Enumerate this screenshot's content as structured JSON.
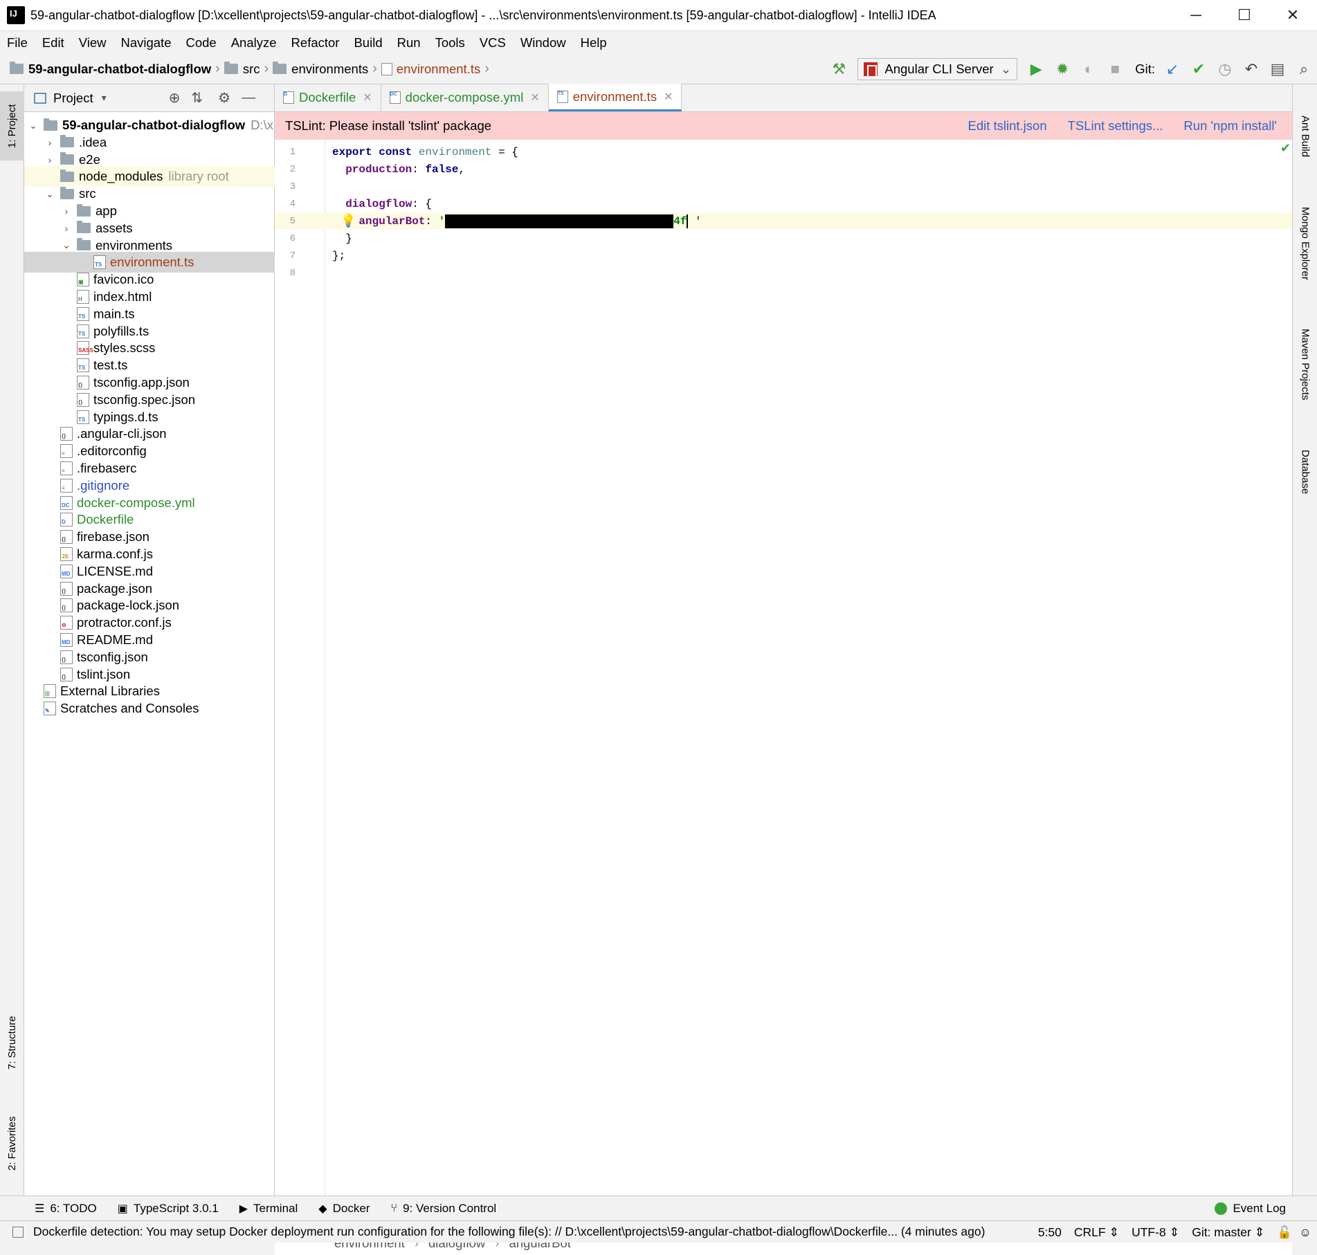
{
  "window": {
    "title": "59-angular-chatbot-dialogflow [D:\\xcellent\\projects\\59-angular-chatbot-dialogflow] - ...\\src\\environments\\environment.ts [59-angular-chatbot-dialogflow] - IntelliJ IDEA",
    "minimize": "─",
    "maximize": "☐",
    "close": "✕"
  },
  "menu": [
    "File",
    "Edit",
    "View",
    "Navigate",
    "Code",
    "Analyze",
    "Refactor",
    "Build",
    "Run",
    "Tools",
    "VCS",
    "Window",
    "Help"
  ],
  "breadcrumb": [
    "59-angular-chatbot-dialogflow",
    "src",
    "environments",
    "environment.ts"
  ],
  "toolbar": {
    "run_config": "Angular CLI Server",
    "git_label": "Git:"
  },
  "left_stripe": {
    "project_tab": "1: Project",
    "structure_tab": "7: Structure",
    "favorites_tab": "2: Favorites"
  },
  "project_panel": {
    "header": "Project",
    "root": "59-angular-chatbot-dialogflow",
    "root_path": "D:\\x",
    "items": [
      {
        "name": ".idea",
        "type": "folder",
        "depth": 1,
        "arrow": "›"
      },
      {
        "name": "e2e",
        "type": "folder",
        "depth": 1,
        "arrow": "›"
      },
      {
        "name": "node_modules",
        "type": "folder",
        "depth": 1,
        "arrow": "",
        "suffix": "library root",
        "highlight": true
      },
      {
        "name": "src",
        "type": "folder",
        "depth": 1,
        "arrow": "⌄"
      },
      {
        "name": "app",
        "type": "folder",
        "depth": 2,
        "arrow": "›"
      },
      {
        "name": "assets",
        "type": "folder",
        "depth": 2,
        "arrow": "›"
      },
      {
        "name": "environments",
        "type": "folder",
        "depth": 2,
        "arrow": "⌄"
      },
      {
        "name": "environment.ts",
        "type": "ts",
        "depth": 3,
        "selected": true
      },
      {
        "name": "favicon.ico",
        "type": "img",
        "depth": 2
      },
      {
        "name": "index.html",
        "type": "html",
        "depth": 2
      },
      {
        "name": "main.ts",
        "type": "ts",
        "depth": 2
      },
      {
        "name": "polyfills.ts",
        "type": "ts",
        "depth": 2
      },
      {
        "name": "styles.scss",
        "type": "sass",
        "depth": 2
      },
      {
        "name": "test.ts",
        "type": "ts",
        "depth": 2
      },
      {
        "name": "tsconfig.app.json",
        "type": "json",
        "depth": 2
      },
      {
        "name": "tsconfig.spec.json",
        "type": "json",
        "depth": 2
      },
      {
        "name": "typings.d.ts",
        "type": "ts",
        "depth": 2
      },
      {
        "name": ".angular-cli.json",
        "type": "json",
        "depth": 1
      },
      {
        "name": ".editorconfig",
        "type": "text",
        "depth": 1
      },
      {
        "name": ".firebaserc",
        "type": "text",
        "depth": 1
      },
      {
        "name": ".gitignore",
        "type": "text",
        "depth": 1,
        "color": "#2f4dbf"
      },
      {
        "name": "docker-compose.yml",
        "type": "dc",
        "depth": 1,
        "color": "#2e8b2e"
      },
      {
        "name": "Dockerfile",
        "type": "docker",
        "depth": 1,
        "color": "#2e8b2e"
      },
      {
        "name": "firebase.json",
        "type": "json",
        "depth": 1
      },
      {
        "name": "karma.conf.js",
        "type": "js",
        "depth": 1
      },
      {
        "name": "LICENSE.md",
        "type": "md",
        "depth": 1
      },
      {
        "name": "package.json",
        "type": "json",
        "depth": 1
      },
      {
        "name": "package-lock.json",
        "type": "json",
        "depth": 1
      },
      {
        "name": "protractor.conf.js",
        "type": "protractor",
        "depth": 1
      },
      {
        "name": "README.md",
        "type": "md",
        "depth": 1
      },
      {
        "name": "tsconfig.json",
        "type": "json",
        "depth": 1
      },
      {
        "name": "tslint.json",
        "type": "json",
        "depth": 1
      },
      {
        "name": "External Libraries",
        "type": "libs",
        "depth": 0
      },
      {
        "name": "Scratches and Consoles",
        "type": "scratch",
        "depth": 0
      }
    ]
  },
  "tabs": [
    {
      "label": "Dockerfile",
      "icon": "D",
      "color": "#2e8b2e",
      "active": false
    },
    {
      "label": "docker-compose.yml",
      "icon": "DC",
      "color": "#2e8b2e",
      "active": false
    },
    {
      "label": "environment.ts",
      "icon": "TS",
      "color": "#a33c14",
      "active": true
    }
  ],
  "tslint_banner": {
    "message": "TSLint: Please install 'tslint' package",
    "actions": [
      "Edit tslint.json",
      "TSLint settings...",
      "Run 'npm install'"
    ]
  },
  "code_lines": [
    "1",
    "2",
    "3",
    "4",
    "5",
    "6",
    "7",
    "8"
  ],
  "code": {
    "kw_export": "export",
    "kw_const": "const",
    "ident_env": "environment",
    "eq_brace": " = {",
    "prop_production": "production",
    "colon": ":",
    "kw_false": "false",
    "comma": ",",
    "prop_dialogflow": "dialogflow",
    "colon_brace": ": {",
    "prop_angularbot": "angularBot",
    "str_open": "'",
    "str_tail": "4f",
    "str_close": " '",
    "close_inner": "}",
    "close_outer": "};"
  },
  "editor_breadcrumb": [
    "environment",
    "dialogflow",
    "angularBot"
  ],
  "right_stripe": [
    "Ant Build",
    "Mongo Explorer",
    "Maven Projects",
    "Database"
  ],
  "tool_windows": [
    {
      "label": "6: TODO",
      "icon": "☰"
    },
    {
      "label": "TypeScript 3.0.1",
      "icon": "▣"
    },
    {
      "label": "Terminal",
      "icon": "▶"
    },
    {
      "label": "Docker",
      "icon": "◆"
    },
    {
      "label": "9: Version Control",
      "icon": "⑂"
    }
  ],
  "event_log": "Event Log",
  "status": {
    "message": "Dockerfile detection: You may setup Docker deployment run configuration for the following file(s): // D:\\xcellent\\projects\\59-angular-chatbot-dialogflow\\Dockerfile... (4 minutes ago)",
    "position": "5:50",
    "line_sep": "CRLF ⇕",
    "encoding": "UTF-8 ⇕",
    "git": "Git: master ⇕"
  }
}
